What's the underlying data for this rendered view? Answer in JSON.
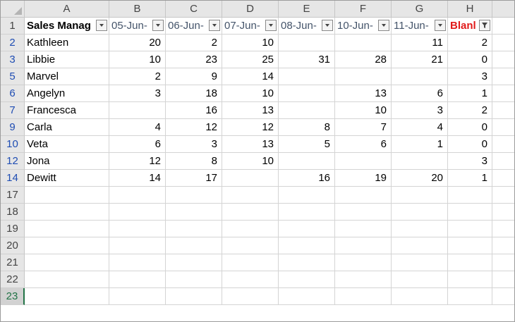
{
  "sheet": {
    "columns": [
      "A",
      "B",
      "C",
      "D",
      "E",
      "F",
      "G",
      "H"
    ],
    "row_numbers": [
      "1",
      "2",
      "3",
      "5",
      "6",
      "7",
      "9",
      "10",
      "12",
      "14",
      "17",
      "18",
      "19",
      "20",
      "21",
      "22",
      "23"
    ],
    "active_row": "23",
    "headers": [
      "Sales Manag",
      "05-Jun-",
      "06-Jun-",
      "07-Jun-",
      "08-Jun-",
      "10-Jun-",
      "11-Jun-",
      "Blanl"
    ],
    "rows": [
      [
        "Kathleen",
        "20",
        "2",
        "10",
        "",
        "",
        "11",
        "2"
      ],
      [
        "Libbie",
        "10",
        "23",
        "25",
        "31",
        "28",
        "21",
        "0"
      ],
      [
        "Marvel",
        "2",
        "9",
        "14",
        "",
        "",
        "",
        "3"
      ],
      [
        "Angelyn",
        "3",
        "18",
        "10",
        "",
        "13",
        "6",
        "1"
      ],
      [
        "Francesca",
        "",
        "16",
        "13",
        "",
        "10",
        "3",
        "2"
      ],
      [
        "Carla",
        "4",
        "12",
        "12",
        "8",
        "7",
        "4",
        "0"
      ],
      [
        "Veta",
        "6",
        "3",
        "13",
        "5",
        "6",
        "1",
        "0"
      ],
      [
        "Jona",
        "12",
        "8",
        "10",
        "",
        "",
        "",
        "3"
      ],
      [
        "Dewitt",
        "14",
        "17",
        "",
        "16",
        "19",
        "20",
        "1"
      ]
    ],
    "filter_icons": {
      "dropdown": "dropdown-arrow-icon",
      "filtered": "filter-funnel-icon"
    },
    "colors": {
      "header_bg": "#e6e6e6",
      "grid": "#d4d4d4",
      "date_header": "#44546a",
      "blanks_header": "#e11a1a",
      "filtered_row_num": "#1f4db3",
      "active_row": "#217346"
    }
  }
}
